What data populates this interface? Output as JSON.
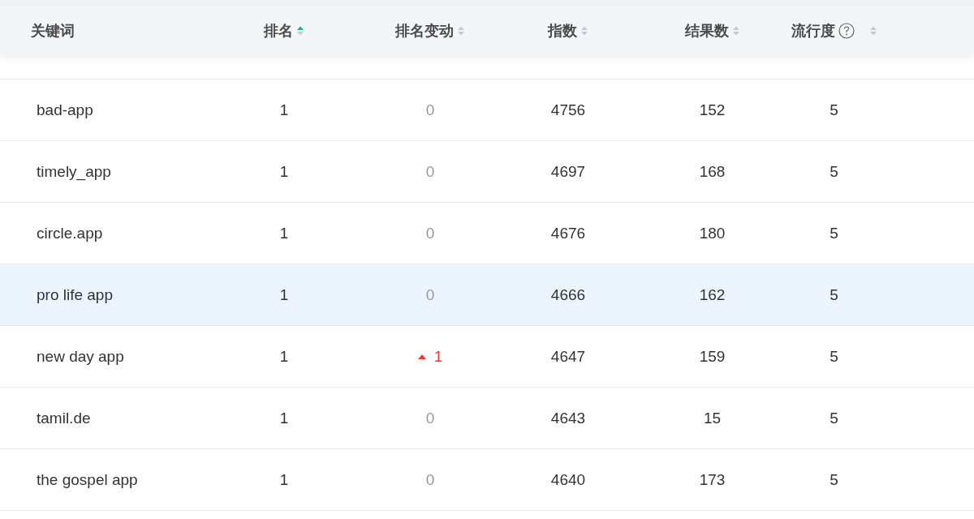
{
  "table": {
    "columns": [
      {
        "label": "关键词"
      },
      {
        "label": "排名",
        "sort_ascending": true
      },
      {
        "label": "排名变动",
        "sort_ascending": false
      },
      {
        "label": "指数",
        "sort_ascending": false
      },
      {
        "label": "结果数",
        "sort_ascending": false
      },
      {
        "label": "流行度",
        "sort_ascending": false,
        "help": true
      }
    ],
    "rows": [
      {
        "keyword": "bad-app",
        "rank": "1",
        "change": {
          "rising": false,
          "value": "0"
        },
        "index": "4756",
        "results": "152",
        "popularity": "5",
        "selected": false
      },
      {
        "keyword": "timely_app",
        "rank": "1",
        "change": {
          "rising": false,
          "value": "0"
        },
        "index": "4697",
        "results": "168",
        "popularity": "5",
        "selected": false
      },
      {
        "keyword": "circle.app",
        "rank": "1",
        "change": {
          "rising": false,
          "value": "0"
        },
        "index": "4676",
        "results": "180",
        "popularity": "5",
        "selected": false
      },
      {
        "keyword": "pro life app",
        "rank": "1",
        "change": {
          "rising": false,
          "value": "0"
        },
        "index": "4666",
        "results": "162",
        "popularity": "5",
        "selected": true
      },
      {
        "keyword": "new day app",
        "rank": "1",
        "change": {
          "rising": true,
          "value": "1"
        },
        "index": "4647",
        "results": "159",
        "popularity": "5",
        "selected": false
      },
      {
        "keyword": "tamil.de",
        "rank": "1",
        "change": {
          "rising": false,
          "value": "0"
        },
        "index": "4643",
        "results": "15",
        "popularity": "5",
        "selected": false
      },
      {
        "keyword": "the gospel app",
        "rank": "1",
        "change": {
          "rising": false,
          "value": "0"
        },
        "index": "4640",
        "results": "173",
        "popularity": "5",
        "selected": false
      }
    ]
  }
}
